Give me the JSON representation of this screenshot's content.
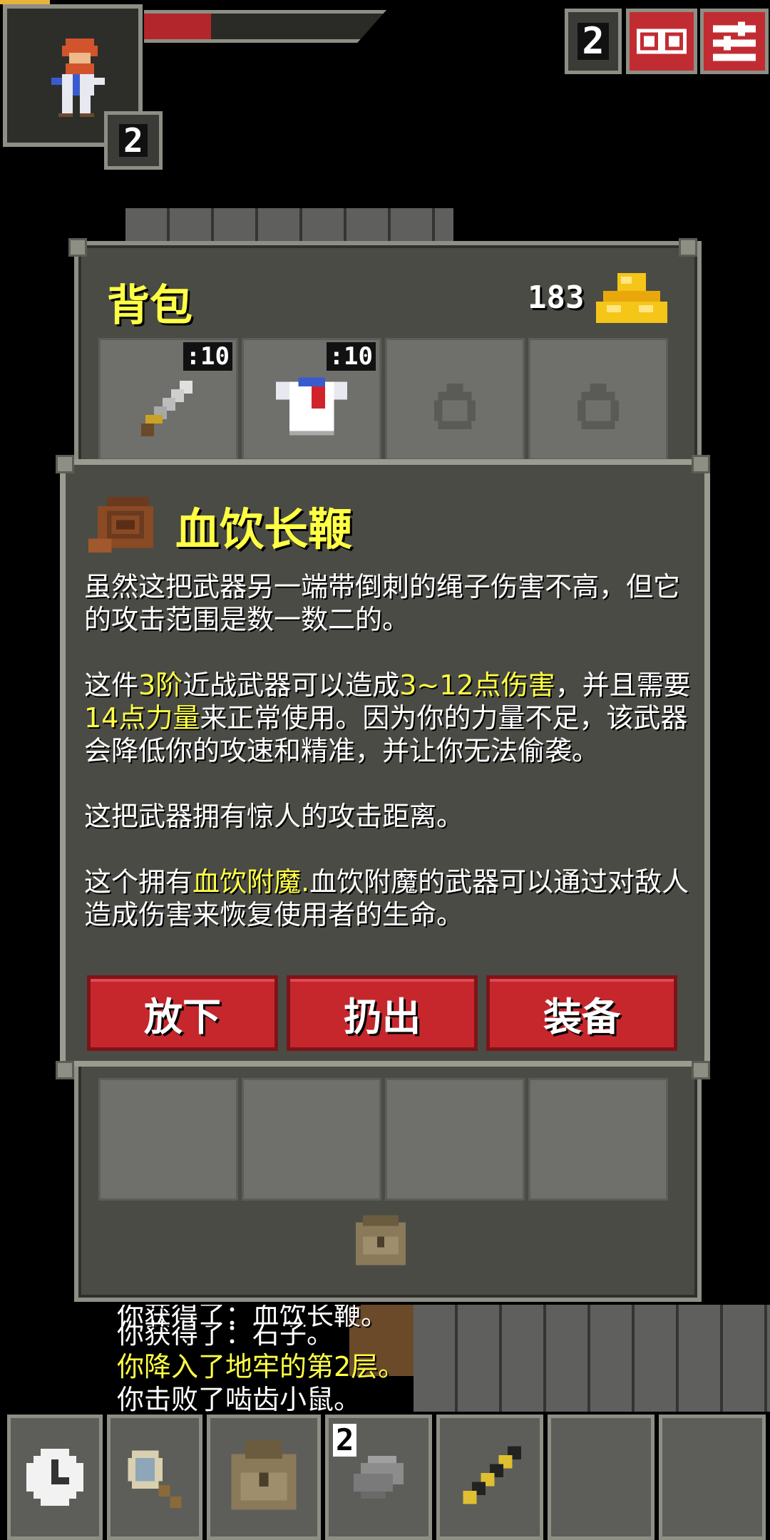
{
  "hud": {
    "hero_level": "2",
    "depth": "2",
    "hp_fraction": 0.28,
    "journal_icon": "journal-icon",
    "menu_icon": "menu-icon"
  },
  "backpack": {
    "title": "背包",
    "gold": "183",
    "slots": [
      {
        "icon": "sword-icon",
        "badge": ":10"
      },
      {
        "icon": "cloth-armor-icon",
        "badge": ":10"
      },
      {
        "icon": "empty-ring-slot-icon",
        "badge": ""
      },
      {
        "icon": "empty-ring-slot-icon",
        "badge": ""
      }
    ],
    "bag_icon": "backpack-icon"
  },
  "item": {
    "icon": "whip-icon",
    "name": "血饮长鞭",
    "desc_p1": "虽然这把武器另一端带倒刺的绳子伤害不高，但它的攻击范围是数一数二的。",
    "desc_p2_a": "这件",
    "desc_p2_tier": "3阶",
    "desc_p2_b": "近战武器可以造成",
    "desc_p2_dmg": "3~12点伤害",
    "desc_p2_c": "，并且需要",
    "desc_p2_str": "14点力量",
    "desc_p2_d": "来正常使用。因为你的力量不足，该武器会降低你的攻速和精准，并让你无法偷袭。",
    "desc_p3": "这把武器拥有惊人的攻击距离。",
    "desc_p4_a": "这个拥有",
    "desc_p4_ench": "血饮附魔.",
    "desc_p4_b": "血饮附魔的武器可以通过对敌人造成伤害来恢复使用者的生命。",
    "buttons": {
      "drop": "放下",
      "throw": "扔出",
      "equip": "装备"
    }
  },
  "log": [
    {
      "text": "你获得了：血饮长鞭。",
      "color": "#ffffff"
    },
    {
      "text": "你获得了：石子。",
      "color": "#ffffff"
    },
    {
      "text": "你降入了地牢的第2层。",
      "color": "#ffff44"
    },
    {
      "text": "你击败了啮齿小鼠。",
      "color": "#ffffff"
    }
  ],
  "toolbar": {
    "wait_icon": "clock-icon",
    "search_icon": "magnifier-icon",
    "bag_icon": "backpack-icon",
    "quickslot1": {
      "icon": "stone-icon",
      "count": "2"
    },
    "quickslot2": {
      "icon": "wand-icon"
    }
  },
  "colors": {
    "highlight": "#ffff44",
    "button_red": "#c5272d",
    "panel": "#4a4b45"
  }
}
